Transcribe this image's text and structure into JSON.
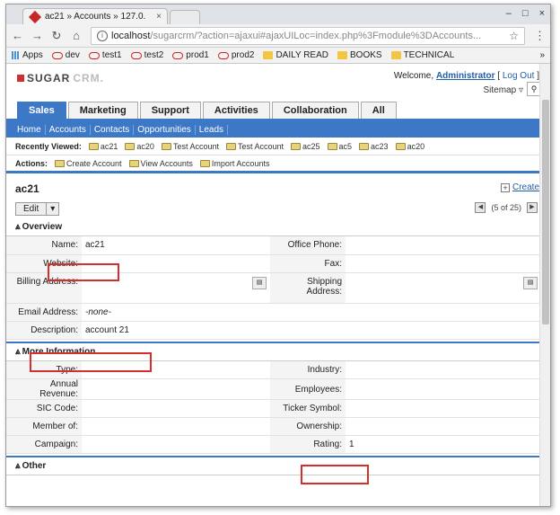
{
  "browser": {
    "tab_title": "ac21 » Accounts » 127.0.",
    "url_host": "localhost",
    "url_path": "/sugarcrm/?action=ajaxui#ajaxUILoc=index.php%3Fmodule%3DAccounts...",
    "bookmarks": [
      "Apps",
      "dev",
      "test1",
      "test2",
      "prod1",
      "prod2",
      "DAILY READ",
      "BOOKS",
      "TECHNICAL"
    ],
    "bookmark_more": "»"
  },
  "header": {
    "logo_sugar": "SUGAR",
    "logo_crm": "CRM.",
    "welcome": "Welcome,",
    "user": "Administrator",
    "logout": "Log Out",
    "sitemap": "Sitemap"
  },
  "modtabs": [
    "Sales",
    "Marketing",
    "Support",
    "Activities",
    "Collaboration",
    "All"
  ],
  "subtabs": [
    "Home",
    "Accounts",
    "Contacts",
    "Opportunities",
    "Leads"
  ],
  "recent": {
    "label": "Recently Viewed:",
    "items": [
      "ac21",
      "ac20",
      "Test Account",
      "Test Account",
      "ac25",
      "ac5",
      "ac23",
      "ac20"
    ]
  },
  "actions": {
    "label": "Actions:",
    "items": [
      "Create Account",
      "View Accounts",
      "Import Accounts"
    ]
  },
  "record": {
    "title": "ac21",
    "create": "Create",
    "edit": "Edit",
    "pager": "(5 of 25)"
  },
  "overview": {
    "title": "Overview",
    "name_label": "Name:",
    "name_value": "ac21",
    "office_phone_label": "Office Phone:",
    "website_label": "Website:",
    "fax_label": "Fax:",
    "billing_label": "Billing Address:",
    "shipping_label": "Shipping Address:",
    "email_label": "Email Address:",
    "email_value": "-none-",
    "description_label": "Description:",
    "description_value": "account 21"
  },
  "more": {
    "title": "More Information",
    "type_label": "Type:",
    "industry_label": "Industry:",
    "revenue_label": "Annual Revenue:",
    "employees_label": "Employees:",
    "sic_label": "SIC Code:",
    "ticker_label": "Ticker Symbol:",
    "member_label": "Member of:",
    "ownership_label": "Ownership:",
    "campaign_label": "Campaign:",
    "rating_label": "Rating:",
    "rating_value": "1"
  },
  "other": {
    "title": "Other"
  },
  "highlight_color": "#d32f2f",
  "accent_color": "#3c78c6"
}
